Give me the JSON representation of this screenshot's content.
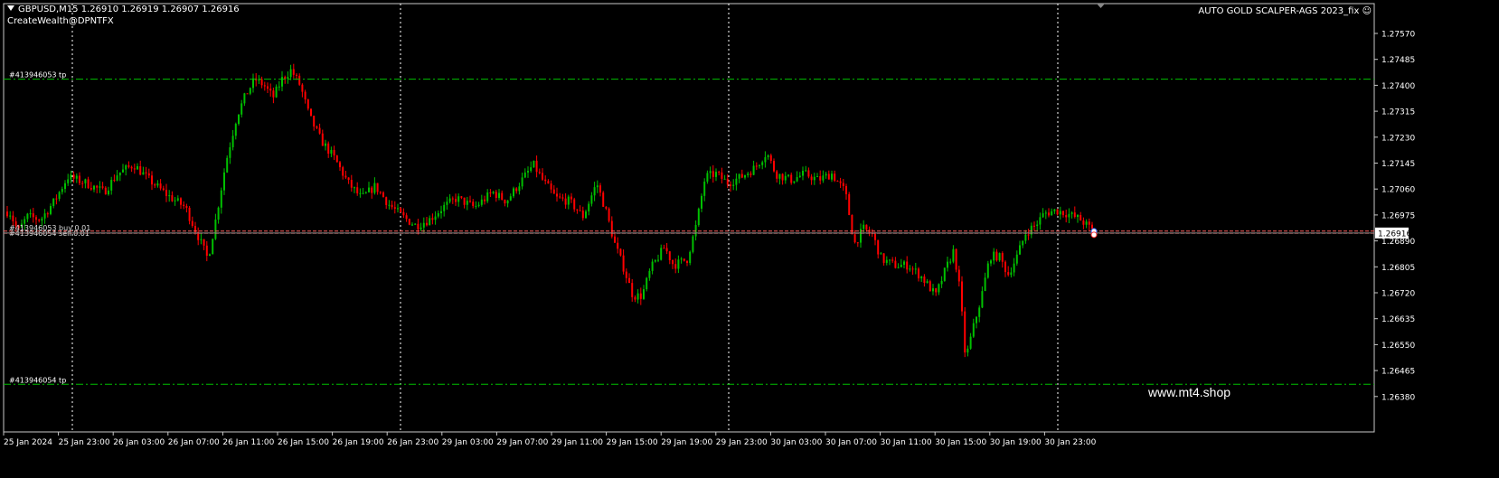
{
  "header": {
    "symbol_info": "GBPUSD,M15  1.26910 1.26919 1.26907 1.26916",
    "subtitle": "CreateWealth@DPNTFX",
    "ea_name": "AUTO GOLD SCALPER-AGS 2023_fix"
  },
  "watermark": "www.mt4.shop",
  "colors": {
    "background": "#000000",
    "bull_candle": "#00c000",
    "bear_candle": "#ff0000",
    "tp_line": "#00c000",
    "order_line": "#ff6060",
    "grid": "#ffffff"
  },
  "chart_data": {
    "type": "candlestick",
    "symbol": "GBPUSD",
    "timeframe": "M15",
    "last": {
      "open": 1.2691,
      "high": 1.26919,
      "low": 1.26907,
      "close": 1.26916
    },
    "current_price": "1.26916",
    "ylim": [
      1.2636,
      1.2762
    ],
    "y_ticks": [
      "1.27570",
      "1.27485",
      "1.27400",
      "1.27315",
      "1.27230",
      "1.27145",
      "1.27060",
      "1.26975",
      "1.26890",
      "1.26805",
      "1.26720",
      "1.26635",
      "1.26550",
      "1.26465",
      "1.26380"
    ],
    "x_ticks": [
      "25 Jan 2024",
      "25 Jan 23:00",
      "26 Jan 03:00",
      "26 Jan 07:00",
      "26 Jan 11:00",
      "26 Jan 15:00",
      "26 Jan 19:00",
      "26 Jan 23:00",
      "29 Jan 03:00",
      "29 Jan 07:00",
      "29 Jan 11:00",
      "29 Jan 15:00",
      "29 Jan 19:00",
      "29 Jan 23:00",
      "30 Jan 03:00",
      "30 Jan 07:00",
      "30 Jan 11:00",
      "30 Jan 15:00",
      "30 Jan 19:00",
      "30 Jan 23:00"
    ],
    "price_path": [
      [
        0,
        1.2697
      ],
      [
        10,
        1.2699
      ],
      [
        20,
        1.2692
      ],
      [
        30,
        1.2697
      ],
      [
        45,
        1.2696
      ],
      [
        60,
        1.2702
      ],
      [
        75,
        1.271
      ],
      [
        95,
        1.2708
      ],
      [
        115,
        1.2705
      ],
      [
        130,
        1.2711
      ],
      [
        148,
        1.2714
      ],
      [
        165,
        1.2709
      ],
      [
        185,
        1.2704
      ],
      [
        205,
        1.27
      ],
      [
        220,
        1.269
      ],
      [
        230,
        1.2683
      ],
      [
        238,
        1.2695
      ],
      [
        250,
        1.2715
      ],
      [
        262,
        1.273
      ],
      [
        272,
        1.2737
      ],
      [
        282,
        1.2742
      ],
      [
        292,
        1.274
      ],
      [
        302,
        1.2736
      ],
      [
        312,
        1.2742
      ],
      [
        322,
        1.2745
      ],
      [
        332,
        1.274
      ],
      [
        342,
        1.273
      ],
      [
        355,
        1.2722
      ],
      [
        370,
        1.2716
      ],
      [
        385,
        1.2708
      ],
      [
        400,
        1.2703
      ],
      [
        415,
        1.2707
      ],
      [
        430,
        1.2701
      ],
      [
        445,
        1.2697
      ],
      [
        460,
        1.2694
      ],
      [
        475,
        1.2696
      ],
      [
        490,
        1.27
      ],
      [
        505,
        1.2703
      ],
      [
        525,
        1.27
      ],
      [
        545,
        1.2705
      ],
      [
        560,
        1.2702
      ],
      [
        575,
        1.2708
      ],
      [
        590,
        1.2714
      ],
      [
        600,
        1.2709
      ],
      [
        615,
        1.2703
      ],
      [
        630,
        1.2702
      ],
      [
        645,
        1.2697
      ],
      [
        660,
        1.2708
      ],
      [
        670,
        1.2699
      ],
      [
        680,
        1.2688
      ],
      [
        690,
        1.268
      ],
      [
        700,
        1.2671
      ],
      [
        710,
        1.2671
      ],
      [
        720,
        1.268
      ],
      [
        735,
        1.2687
      ],
      [
        745,
        1.2681
      ],
      [
        760,
        1.2683
      ],
      [
        770,
        1.2694
      ],
      [
        780,
        1.271
      ],
      [
        792,
        1.2711
      ],
      [
        805,
        1.2708
      ],
      [
        820,
        1.271
      ],
      [
        835,
        1.2713
      ],
      [
        848,
        1.2718
      ],
      [
        858,
        1.2711
      ],
      [
        875,
        1.2709
      ],
      [
        890,
        1.2711
      ],
      [
        905,
        1.2709
      ],
      [
        920,
        1.2711
      ],
      [
        935,
        1.2705
      ],
      [
        945,
        1.2688
      ],
      [
        955,
        1.2693
      ],
      [
        965,
        1.2691
      ],
      [
        975,
        1.2683
      ],
      [
        990,
        1.2681
      ],
      [
        1005,
        1.2681
      ],
      [
        1020,
        1.2677
      ],
      [
        1035,
        1.2671
      ],
      [
        1045,
        1.2679
      ],
      [
        1055,
        1.2686
      ],
      [
        1062,
        1.2672
      ],
      [
        1068,
        1.265
      ],
      [
        1076,
        1.266
      ],
      [
        1085,
        1.267
      ],
      [
        1095,
        1.2684
      ],
      [
        1105,
        1.2684
      ],
      [
        1115,
        1.2678
      ],
      [
        1125,
        1.2684
      ],
      [
        1135,
        1.2692
      ],
      [
        1145,
        1.2694
      ],
      [
        1155,
        1.2698
      ],
      [
        1168,
        1.2699
      ],
      [
        1180,
        1.2698
      ],
      [
        1195,
        1.2696
      ],
      [
        1210,
        1.2692
      ]
    ],
    "horizontal_lines": [
      {
        "label": "#413946053 tp",
        "price": 1.2742,
        "style": "tp"
      },
      {
        "label": "#413946054 tp",
        "price": 1.2642,
        "style": "tp"
      },
      {
        "label": "#413946053 buy 0.01",
        "price": 1.26922,
        "style": "order"
      },
      {
        "label": "#413946054 sell 0.01",
        "price": 1.26915,
        "style": "order"
      }
    ],
    "grid": true
  }
}
